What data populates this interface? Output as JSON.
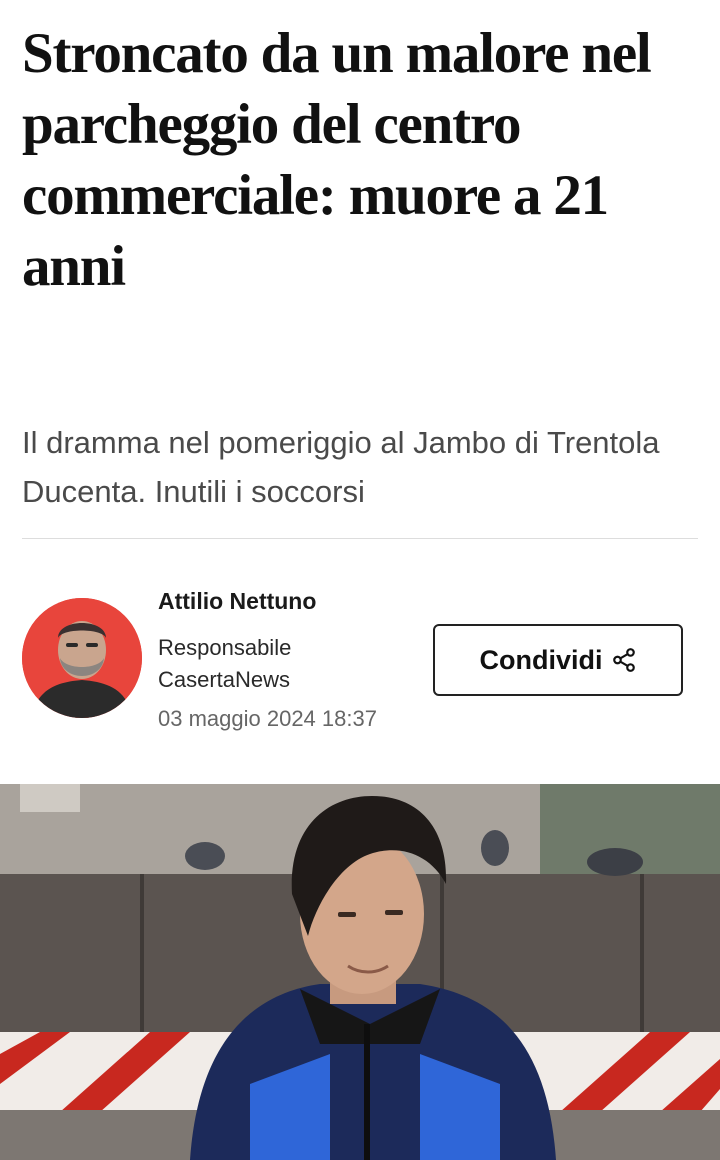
{
  "article": {
    "headline": "Stroncato da un malore nel parcheggio del centro commerciale: muore a 21 anni",
    "subtitle": "Il dramma nel pomeriggio al Jambo di Trentola Ducenta. Inutili i soccorsi"
  },
  "author": {
    "name": "Attilio Nettuno",
    "role": "Responsabile CasertaNews",
    "date": "03 maggio 2024 18:37",
    "avatar_bg": "#e8453c"
  },
  "share": {
    "label": "Condividi",
    "icon": "share-icon"
  },
  "image": {
    "subject": "young man in blue and black jacket in front of red-and-white striped barrier"
  }
}
